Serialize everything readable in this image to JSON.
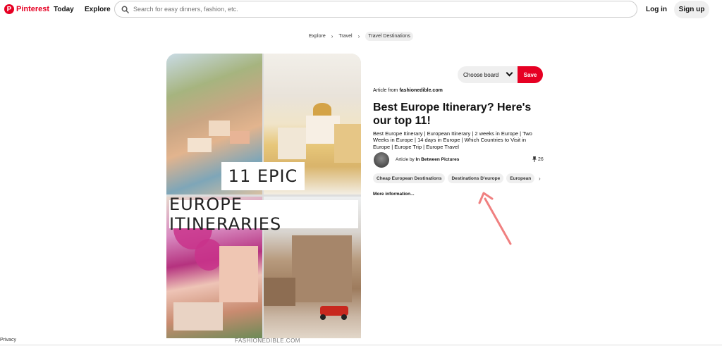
{
  "header": {
    "logo_text": "Pinterest",
    "nav_today": "Today",
    "nav_explore": "Explore",
    "search_placeholder": "Search for easy dinners, fashion, etc.",
    "login": "Log in",
    "signup": "Sign up"
  },
  "breadcrumb": {
    "items": [
      "Explore",
      "Travel",
      "Travel Destinations"
    ]
  },
  "pin": {
    "image_text_line1": "11 EPIC",
    "image_text_line2": "EUROPE ITINERARIES",
    "watermark": "FASHIONEDIBLE.COM",
    "board_select": "Choose board",
    "save_button": "Save",
    "article_from_prefix": "Article from",
    "article_from_domain": "fashionedible.com",
    "title": "Best Europe Itinerary? Here's our top 11!",
    "description": "Best Europe Itinerary | European Itinerary | 2 weeks in Europe | Two Weeks in Europe | 14 days in Europe | Which Countries to Visit in Europe | Europe Trip | Europe Travel",
    "article_by_prefix": "Article by",
    "article_by_author": "In Between Pictures",
    "save_count": "26",
    "tags": [
      "Cheap European Destinations",
      "Destinations D'europe",
      "European"
    ],
    "more_info": "More information..."
  },
  "footer": {
    "privacy": "Privacy"
  },
  "colors": {
    "brand": "#e60023",
    "annotation_arrow": "#f08080"
  }
}
